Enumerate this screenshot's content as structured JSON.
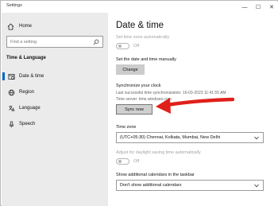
{
  "window": {
    "title": "Settings",
    "minimize_glyph": "—",
    "maximize_glyph": "☐",
    "close_glyph": "✕"
  },
  "sidebar": {
    "home_label": "Home",
    "search_placeholder": "Find a setting",
    "section_title": "Time & Language",
    "items": [
      {
        "label": "Date & time",
        "icon": "date-time-icon",
        "active": true
      },
      {
        "label": "Region",
        "icon": "globe-icon",
        "active": false
      },
      {
        "label": "Language",
        "icon": "language-icon",
        "active": false
      },
      {
        "label": "Speech",
        "icon": "microphone-icon",
        "active": false
      }
    ]
  },
  "main": {
    "page_title": "Date & time",
    "set_time_zone_auto": {
      "label": "Set time zone automatically",
      "state": "Off",
      "enabled": false
    },
    "set_manually": {
      "label": "Set the date and time manually",
      "button": "Change"
    },
    "sync": {
      "heading": "Synchronize your clock",
      "last_sync": "Last successful time synchronization: 16-03-2023 11:41:55 AM",
      "server": "Time server: time.windows.com",
      "button": "Sync now"
    },
    "time_zone": {
      "label": "Time zone",
      "value": "(UTC+05:30) Chennai, Kolkata, Mumbai, New Delhi"
    },
    "daylight": {
      "label": "Adjust for daylight saving time automatically",
      "state": "Off",
      "enabled": false
    },
    "calendars": {
      "label": "Show additional calendars in the taskbar",
      "value": "Don't show additional calendars"
    }
  },
  "colors": {
    "accent": "#0067c0",
    "annotation_arrow": "#e0201b",
    "sidebar_bg": "#ebebeb",
    "button_bg": "#cccccc"
  }
}
